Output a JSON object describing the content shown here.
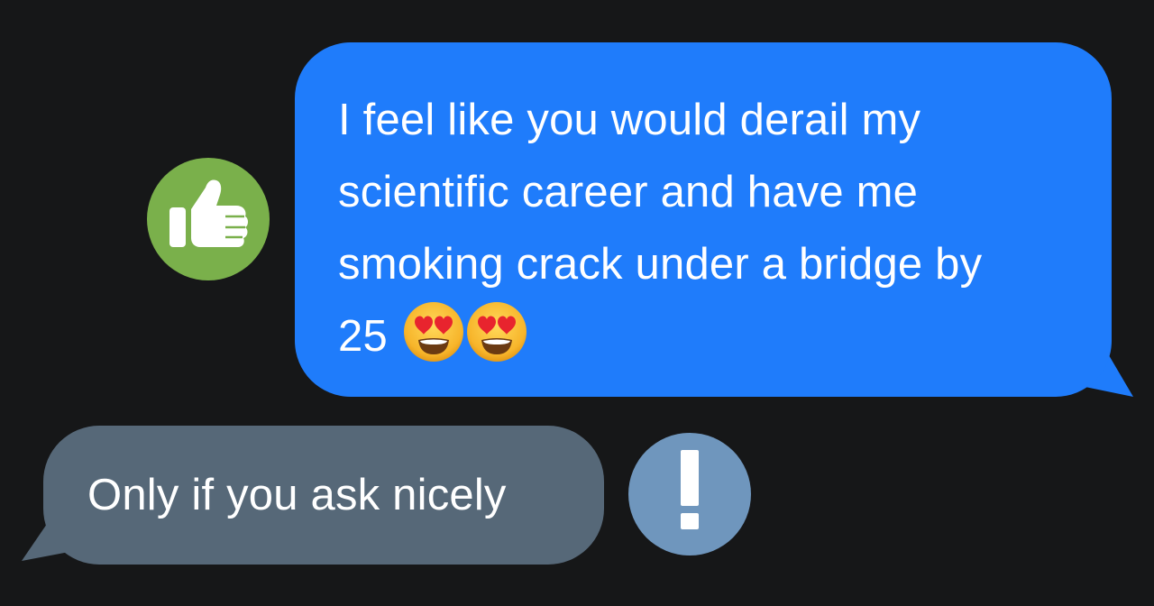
{
  "messages": {
    "sent": {
      "text": "I feel like you would derail my\nscientific career and have me\nsmoking crack under a bridge by\n25",
      "emojis": [
        "heart-eyes-face",
        "heart-eyes-face"
      ],
      "reaction": "thumbs-up"
    },
    "received": {
      "text": "Only if you ask nicely",
      "reaction": "exclamation"
    }
  },
  "colors": {
    "background": "#161718",
    "sent_bubble": "#1f7cfb",
    "received_bubble": "#566878",
    "like_badge": "#7ab04b",
    "exclaim_badge": "#6f96bd"
  }
}
